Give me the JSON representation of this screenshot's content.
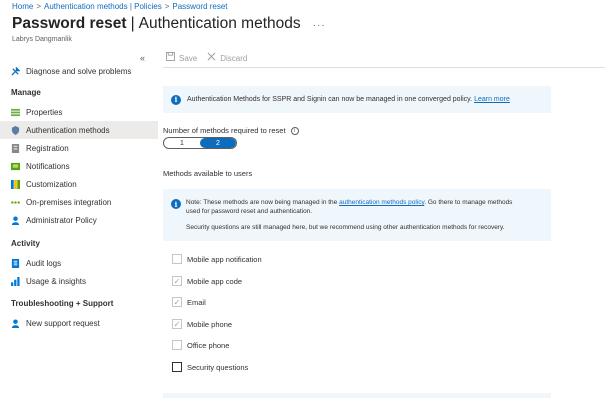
{
  "breadcrumb": {
    "home": "Home",
    "middle": "Authentication methods | Policies",
    "current": "Password reset",
    "separator": ">"
  },
  "header": {
    "title_main": "Password reset",
    "title_bar": "|",
    "title_sub": "Authentication methods",
    "more": "···",
    "subtitle": "Labrys Dangmanlik",
    "collapse": "«"
  },
  "sidebar": {
    "diagnose": "Diagnose and solve problems",
    "manage_header": "Manage",
    "manage_items": [
      {
        "label": "Properties",
        "icon": "properties-icon"
      },
      {
        "label": "Authentication methods",
        "icon": "shield-icon"
      },
      {
        "label": "Registration",
        "icon": "registration-icon"
      },
      {
        "label": "Notifications",
        "icon": "notifications-icon"
      },
      {
        "label": "Customization",
        "icon": "customization-icon"
      },
      {
        "label": "On-premises integration",
        "icon": "integration-icon"
      },
      {
        "label": "Administrator Policy",
        "icon": "policy-icon"
      }
    ],
    "activity_header": "Activity",
    "activity_items": [
      {
        "label": "Audit logs",
        "icon": "audit-log-icon"
      },
      {
        "label": "Usage & insights",
        "icon": "insights-icon"
      }
    ],
    "support_header": "Troubleshooting + Support",
    "support_items": [
      {
        "label": "New support request",
        "icon": "support-request-icon"
      }
    ]
  },
  "toolbar": {
    "save_label": "Save",
    "discard_label": "Discard"
  },
  "info_banner": {
    "text": "Authentication Methods for SSPR and Signin can now be managed in one converged policy.",
    "link": "Learn more"
  },
  "methods_required": {
    "label": "Number of methods required to reset",
    "options": [
      "1",
      "2"
    ],
    "selected": "2"
  },
  "methods_available_label": "Methods available to users",
  "note": {
    "line1_pre": "Note: These methods are now being managed in the",
    "line1_link": "authentication methods policy",
    "line1_post": ". Go there to manage methods",
    "line2": "used for password reset and authentication.",
    "line3": "Security questions are still managed here, but we recommend using other authentication methods for recovery."
  },
  "methods": [
    {
      "label": "Mobile app notification",
      "checked": false
    },
    {
      "label": "Mobile app code",
      "checked": true
    },
    {
      "label": "Email",
      "checked": true
    },
    {
      "label": "Mobile phone",
      "checked": true
    },
    {
      "label": "Office phone",
      "checked": false
    },
    {
      "label": "Security questions",
      "checked": false
    }
  ],
  "colors": {
    "accent": "#0f6cbd",
    "info_bg": "#eff6fc",
    "active_nav_bg": "#edebe9"
  }
}
